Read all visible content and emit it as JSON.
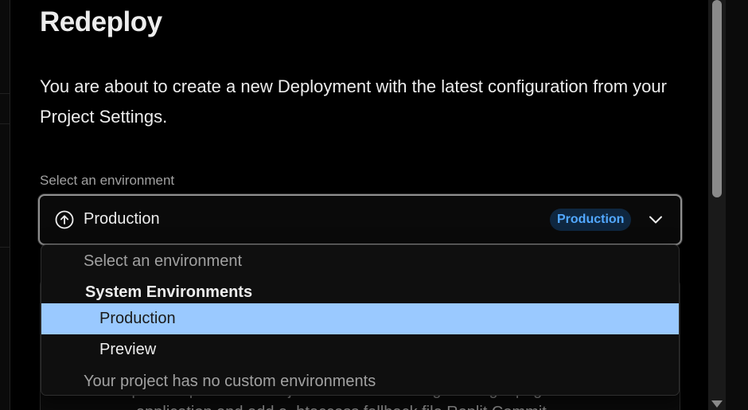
{
  "modal": {
    "title": "Redeploy",
    "description": "You are about to create a new Deployment with the latest configuration from your Project Settings."
  },
  "environment_select": {
    "label": "Select an environment",
    "value": "Production",
    "icon": "arrow-up-circle-icon",
    "badge": "Production",
    "chevron": "chevron-down-icon"
  },
  "dropdown": {
    "placeholder": "Select an environment",
    "group_label": "System Environments",
    "options": [
      {
        "label": "Production",
        "selected": true
      },
      {
        "label": "Preview",
        "selected": false
      }
    ],
    "note": "Your project has no custom environments"
  },
  "background_content": {
    "line1": "requests Updates vercel.json to correct routing for single-page",
    "line2": "application and add a .htaccess fallback file Replit Commit"
  },
  "colors": {
    "selected_option_bg": "#9ac9ff",
    "badge_bg": "#0f2740",
    "badge_text": "#52a8ff"
  }
}
